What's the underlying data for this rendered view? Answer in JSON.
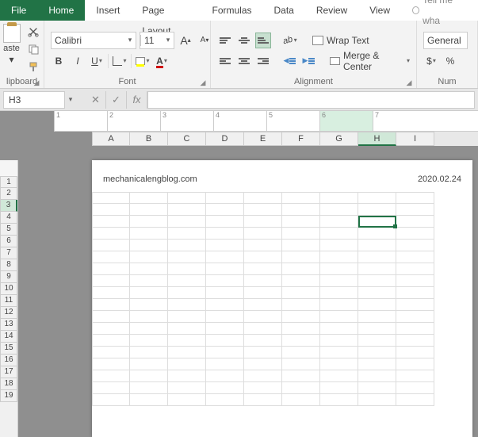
{
  "tabs": {
    "file": "File",
    "home": "Home",
    "insert": "Insert",
    "page_layout": "Page Layout",
    "formulas": "Formulas",
    "data": "Data",
    "review": "Review",
    "view": "View",
    "tellme": "Tell me wha"
  },
  "clipboard": {
    "paste": "aste",
    "label": "lipboard"
  },
  "font": {
    "name": "Calibri",
    "size": "11",
    "bold": "B",
    "italic": "I",
    "underline": "U",
    "grow": "A",
    "shrink": "A",
    "color_letter": "A",
    "label": "Font"
  },
  "alignment": {
    "wrap": "Wrap Text",
    "merge": "Merge & Center",
    "orient": "ab",
    "label": "Alignment"
  },
  "number": {
    "format": "General",
    "currency": "$",
    "percent": "%",
    "label": "Num"
  },
  "namebox": "H3",
  "fx": "fx",
  "columns": [
    "A",
    "B",
    "C",
    "D",
    "E",
    "F",
    "G",
    "H",
    "I"
  ],
  "selected_col": "H",
  "rows": [
    "1",
    "2",
    "3",
    "4",
    "5",
    "6",
    "7",
    "8",
    "9",
    "10",
    "11",
    "12",
    "13",
    "14",
    "15",
    "16",
    "17",
    "18",
    "19"
  ],
  "selected_row": "3",
  "ruler_labels": [
    "1",
    "2",
    "3",
    "4",
    "5",
    "6",
    "7"
  ],
  "page": {
    "hdr_left": "mechanicalengblog.com",
    "hdr_right": "2020.02.24"
  }
}
